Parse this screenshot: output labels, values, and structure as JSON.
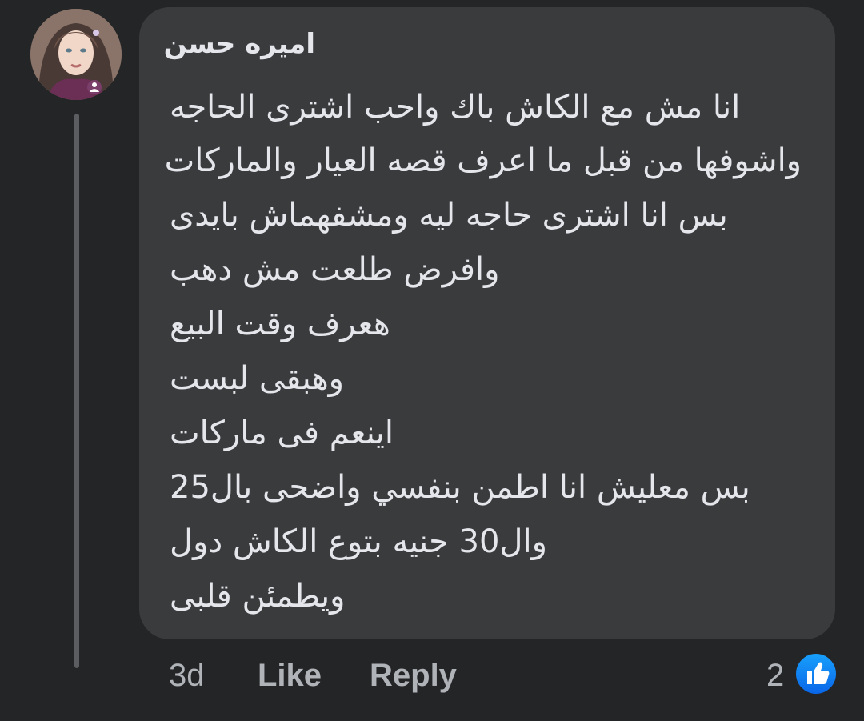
{
  "comment": {
    "author": "اميره حسن",
    "lines": [
      "انا مش مع الكاش باك واحب اشترى الحاجه",
      "واشوفها من قبل ما اعرف قصه العيار والماركات",
      "بس انا اشترى حاجه ليه ومشفهماش بايدى",
      "وافرض طلعت مش دهب",
      "هعرف وقت البيع",
      "وهبقى لبست",
      "اينعم فى ماركات",
      "بس معليش انا اطمن بنفسي واضحى بال25",
      "وال30 جنيه بتوع الكاش دول",
      "ويطمئن قلبى"
    ]
  },
  "actions": {
    "time": "3d",
    "like_label": "Like",
    "reply_label": "Reply"
  },
  "reactions": {
    "count": "2",
    "icon": "thumbs-up-icon",
    "icon_color": "#1877f2"
  },
  "colors": {
    "background": "#242527",
    "bubble": "#3a3b3d",
    "text": "#e4e6eb",
    "secondary_text": "#b0b3b8"
  }
}
